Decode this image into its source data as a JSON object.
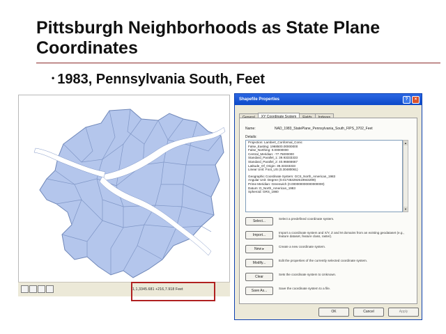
{
  "slide": {
    "title": "Pittsburgh Neighborhoods as State Plane Coordinates",
    "bullet": "1983, Pennsylvania South, Feet"
  },
  "map_window": {
    "status_coords": "1,1,3345.681  +216,7.918 Feet",
    "map_fill": "#b4c6ec",
    "river_fill": "#ffffff",
    "highlight_color": "#b02020"
  },
  "dialog": {
    "title": "Shapefile Properties",
    "help_label": "?",
    "close_label": "×",
    "tabs": [
      "General",
      "XY Coordinate System",
      "Fields",
      "Indexes"
    ],
    "name_label": "Name:",
    "name_value": "NAD_1983_StatePlane_Pennsylvania_South_FIPS_3702_Feet",
    "details_label": "Details:",
    "details_lines": [
      "Projection: Lambert_Conformal_Conic",
      "False_Easting: 1968500.00000000",
      "False_Northing: 0.00000000",
      "Central_Meridian: -77.75000000",
      "Standard_Parallel_1: 39.93333333",
      "Standard_Parallel_2: 40.96666667",
      "Latitude_Of_Origin: 39.33333333",
      "Linear Unit: Foot_US (0.30480061)",
      "",
      "Geographic Coordinate System: GCS_North_American_1983",
      "Angular Unit: Degree (0.017453292519943299)",
      "Prime Meridian: Greenwich (0.000000000000000000)",
      "Datum: D_North_American_1983",
      "  Spheroid: GRS_1980"
    ],
    "buttons": [
      {
        "label": "Select...",
        "desc": "Select a predefined coordinate system."
      },
      {
        "label": "Import...",
        "desc": "Import a coordinate system and X/Y, Z and M domains from an existing geodataset (e.g., feature dataset, feature class, raster)."
      },
      {
        "label": "New ▸",
        "desc": "Create a new coordinate system."
      },
      {
        "label": "Modify...",
        "desc": "Edit the properties of the currently selected coordinate system."
      },
      {
        "label": "Clear",
        "desc": "Sets the coordinate system to Unknown."
      },
      {
        "label": "Save As...",
        "desc": "Save the coordinate system to a file."
      }
    ],
    "ok_label": "OK",
    "cancel_label": "Cancel",
    "apply_label": "Apply"
  }
}
